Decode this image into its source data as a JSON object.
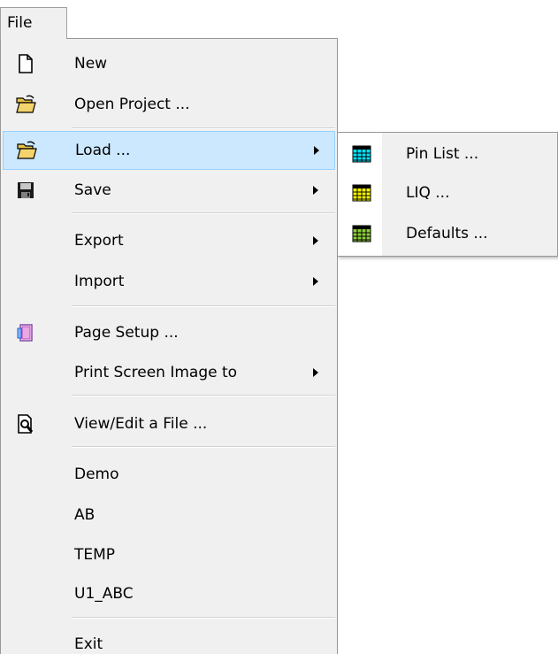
{
  "menubar": {
    "file_label": "File"
  },
  "menu": {
    "items": [
      {
        "label": "New",
        "icon": "new-document-icon"
      },
      {
        "label": "Open Project ...",
        "icon": "open-folder-icon"
      },
      {
        "label": "Load ...",
        "icon": "open-folder-icon",
        "submenu": true,
        "highlighted": true
      },
      {
        "label": "Save",
        "icon": "floppy-disk-icon",
        "submenu": true
      },
      {
        "label": "Export",
        "submenu": true
      },
      {
        "label": "Import",
        "submenu": true
      },
      {
        "label": "Page Setup ...",
        "icon": "page-setup-icon"
      },
      {
        "label": "Print Screen Image to",
        "submenu": true
      },
      {
        "label": "View/Edit a File ...",
        "icon": "view-file-icon"
      },
      {
        "label": "Demo"
      },
      {
        "label": "AB"
      },
      {
        "label": "TEMP"
      },
      {
        "label": "U1_ABC"
      },
      {
        "label": "Exit"
      }
    ]
  },
  "submenu": {
    "items": [
      {
        "label": "Pin List ...",
        "icon": "grid-icon",
        "color": "#00e5ff"
      },
      {
        "label": "LIQ ...",
        "icon": "grid-icon",
        "color": "#ffff00"
      },
      {
        "label": "Defaults ...",
        "icon": "grid-icon",
        "color": "#8ccf3c"
      }
    ]
  },
  "colors": {
    "menu_background": "#f0f0f0",
    "highlight_background": "#cce8ff",
    "highlight_border": "#99d1ff"
  }
}
